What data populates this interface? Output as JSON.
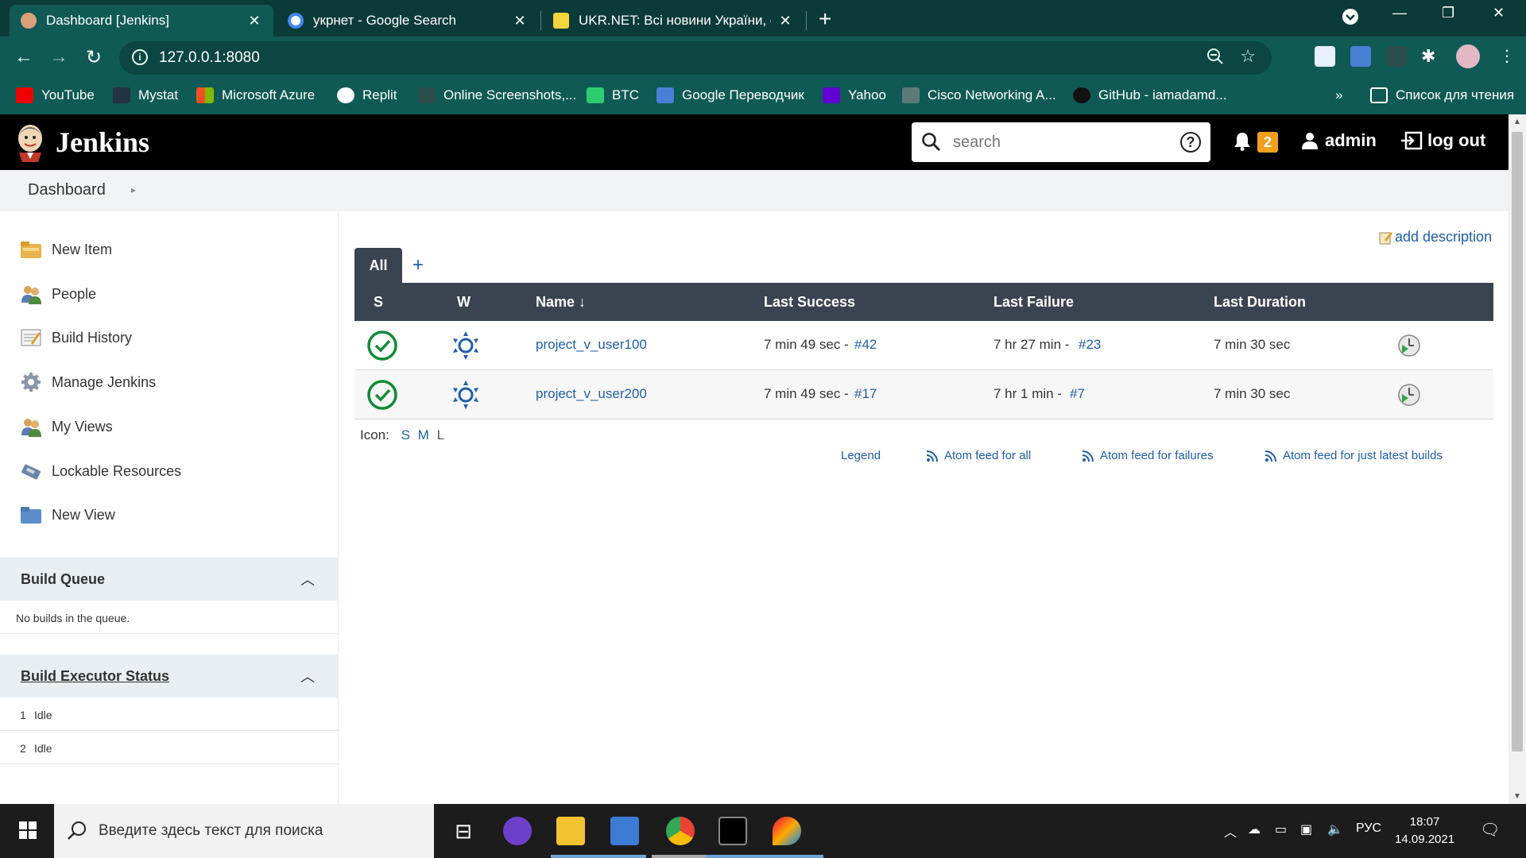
{
  "browser": {
    "tabs": [
      {
        "title": "Dashboard [Jenkins]",
        "active": true
      },
      {
        "title": "укрнет - Google Search",
        "active": false
      },
      {
        "title": "UKR.NET: Всі новини України, ос",
        "active": false
      }
    ],
    "url": "127.0.0.1:8080",
    "bookmarks": [
      "YouTube",
      "Mystat",
      "Microsoft Azure",
      "Replit",
      "Online Screenshots,...",
      "BTC",
      "Google Переводчик",
      "Yahoo",
      "Cisco Networking A...",
      "GitHub - iamadamd..."
    ],
    "overflow": "»",
    "reading_list": "Список для чтения"
  },
  "jenkins": {
    "title": "Jenkins",
    "search_placeholder": "search",
    "notification_count": "2",
    "user": "admin",
    "logout": "log out",
    "breadcrumb": "Dashboard",
    "sidebar": {
      "items": [
        "New Item",
        "People",
        "Build History",
        "Manage Jenkins",
        "My Views",
        "Lockable Resources",
        "New View"
      ],
      "build_queue": {
        "title": "Build Queue",
        "empty": "No builds in the queue."
      },
      "executors": {
        "title": "Build Executor Status",
        "rows": [
          {
            "num": "1",
            "status": "Idle"
          },
          {
            "num": "2",
            "status": "Idle"
          }
        ]
      }
    },
    "main": {
      "add_description": "add description",
      "view_tab": "All",
      "view_add": "+",
      "columns": {
        "s": "S",
        "w": "W",
        "name": "Name ↓",
        "last_success": "Last Success",
        "last_failure": "Last Failure",
        "last_duration": "Last Duration"
      },
      "jobs": [
        {
          "name": "project_v_user100",
          "success_time": "7 min 49 sec -",
          "success_build": "#42",
          "failure_time": "7 hr 27 min -",
          "failure_build": "#23",
          "duration": "7 min 30 sec"
        },
        {
          "name": "project_v_user200",
          "success_time": "7 min 49 sec -",
          "success_build": "#17",
          "failure_time": "7 hr 1 min -",
          "failure_build": "#7",
          "duration": "7 min 30 sec"
        }
      ],
      "icon_label": "Icon:",
      "icon_sizes": [
        "S",
        "M",
        "L"
      ],
      "legend": "Legend",
      "feeds": [
        "Atom feed for all",
        "Atom feed for failures",
        "Atom feed for just latest builds"
      ]
    }
  },
  "taskbar": {
    "search_placeholder": "Введите здесь текст для поиска",
    "language": "РУС",
    "time": "18:07",
    "date": "14.09.2021"
  },
  "colors": {
    "chrome_dark": "#0b3b38",
    "chrome": "#0f5a54",
    "jenkins_header": "#000000",
    "link": "#1f5ea8",
    "table_header": "#3a4450",
    "success": "#138a36",
    "badge": "#f1a01e"
  }
}
